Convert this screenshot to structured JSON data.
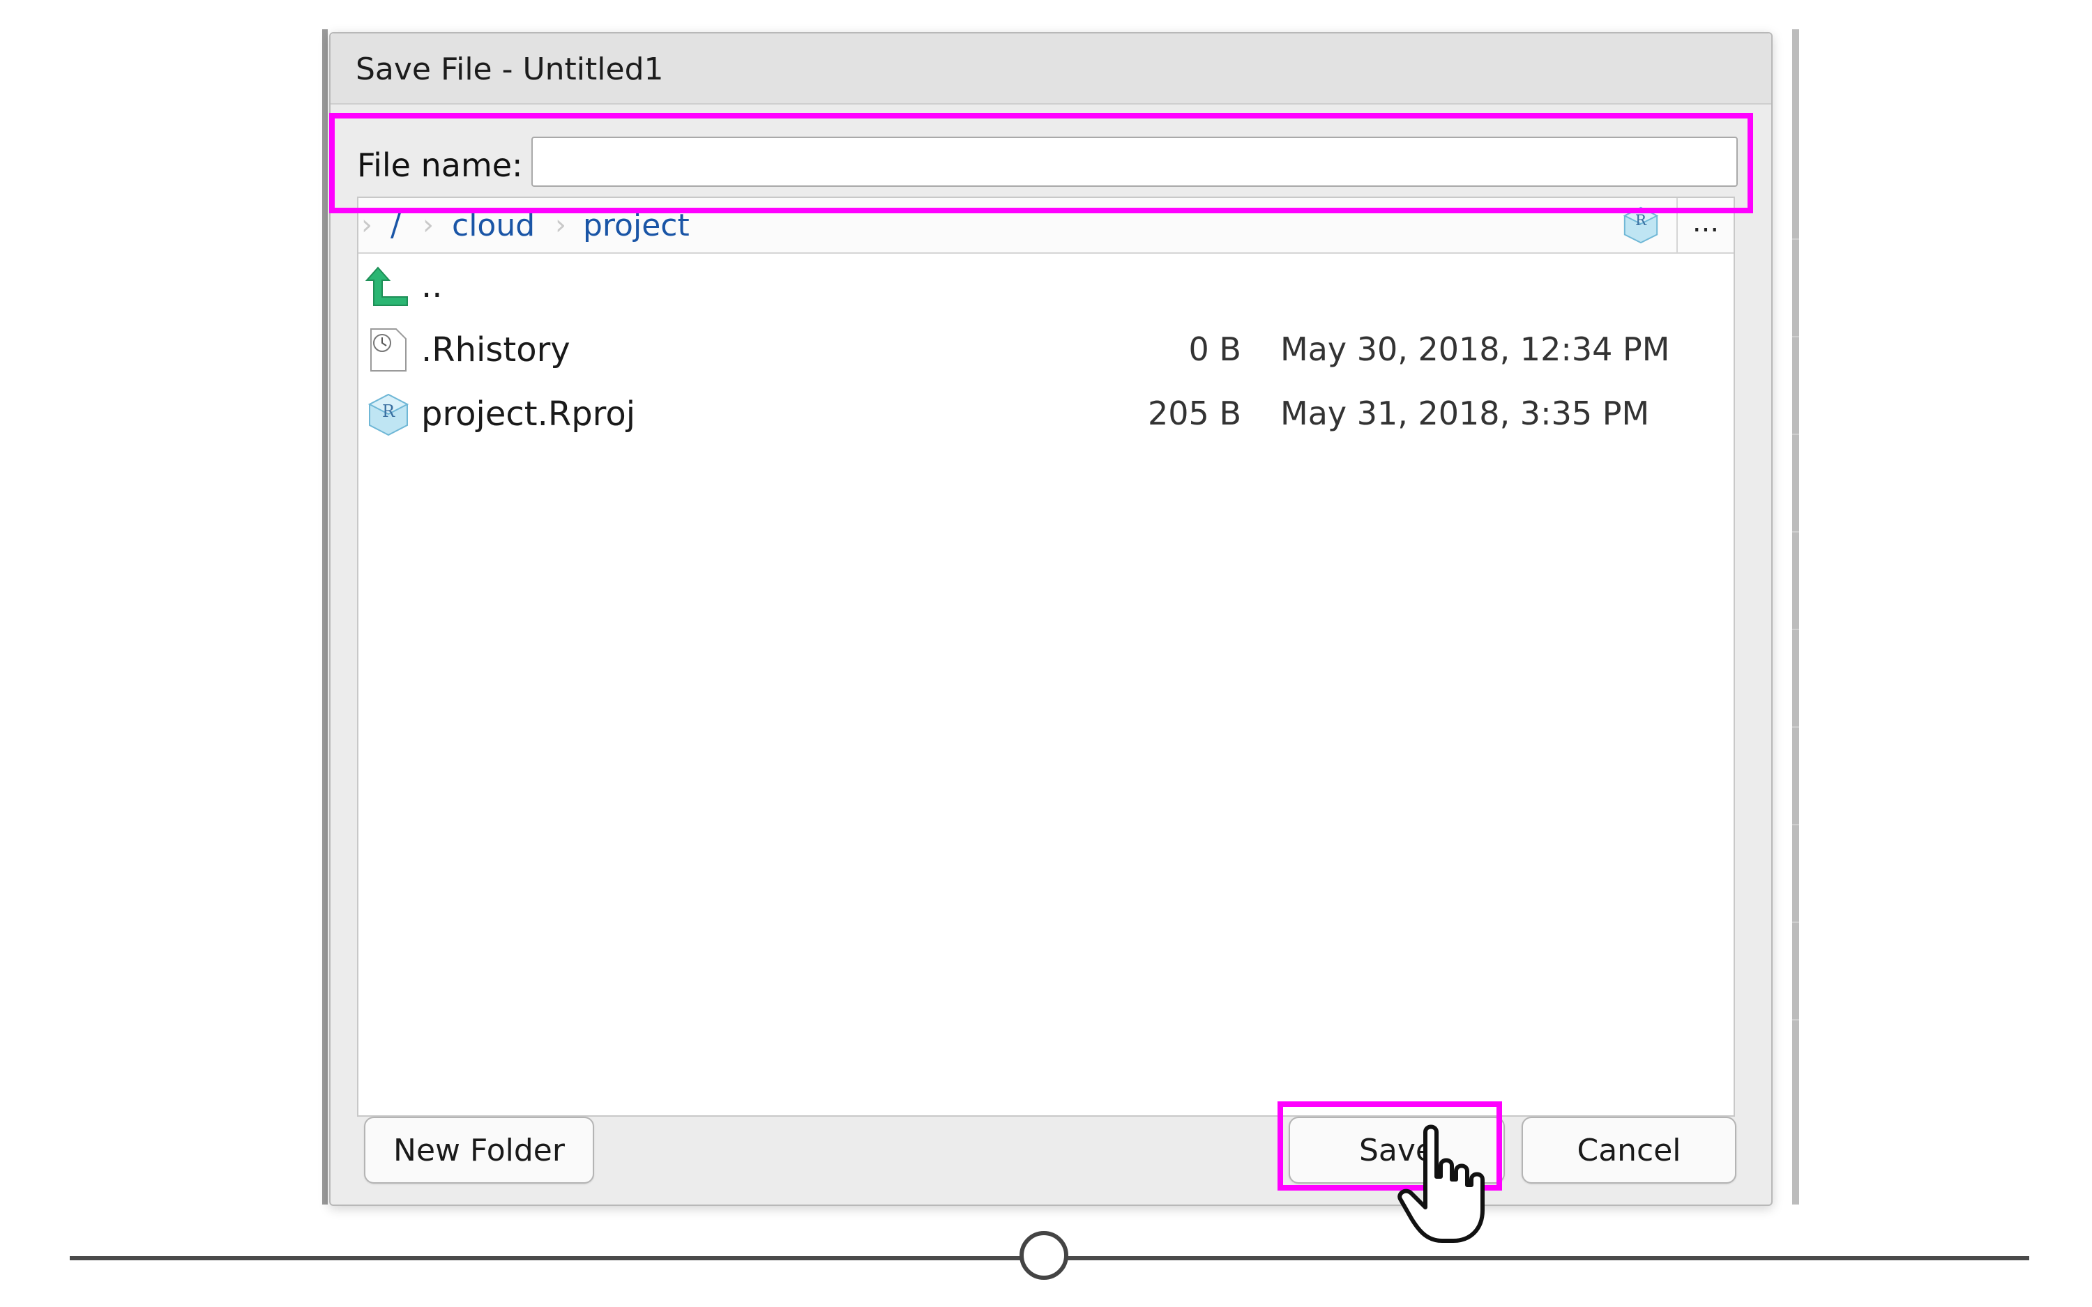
{
  "dialog": {
    "title": "Save File - Untitled1",
    "filename_label": "File name:",
    "filename_value": "",
    "breadcrumb": [
      "/",
      "cloud",
      "project"
    ],
    "more_label": "...",
    "files": [
      {
        "name": "..",
        "size": "",
        "modified": "",
        "icon": "parent-folder-icon"
      },
      {
        "name": ".Rhistory",
        "size": "0 B",
        "modified": "May 30, 2018, 12:34 PM",
        "icon": "history-file-icon"
      },
      {
        "name": "project.Rproj",
        "size": "205 B",
        "modified": "May 31, 2018, 3:35 PM",
        "icon": "rproj-icon"
      }
    ],
    "buttons": {
      "new_folder": "New Folder",
      "save": "Save",
      "cancel": "Cancel"
    }
  },
  "colors": {
    "highlight": "#ff00ff",
    "link": "#1a55a6",
    "arrow": "#2bb673"
  },
  "timeline": {
    "position": 0.5
  }
}
